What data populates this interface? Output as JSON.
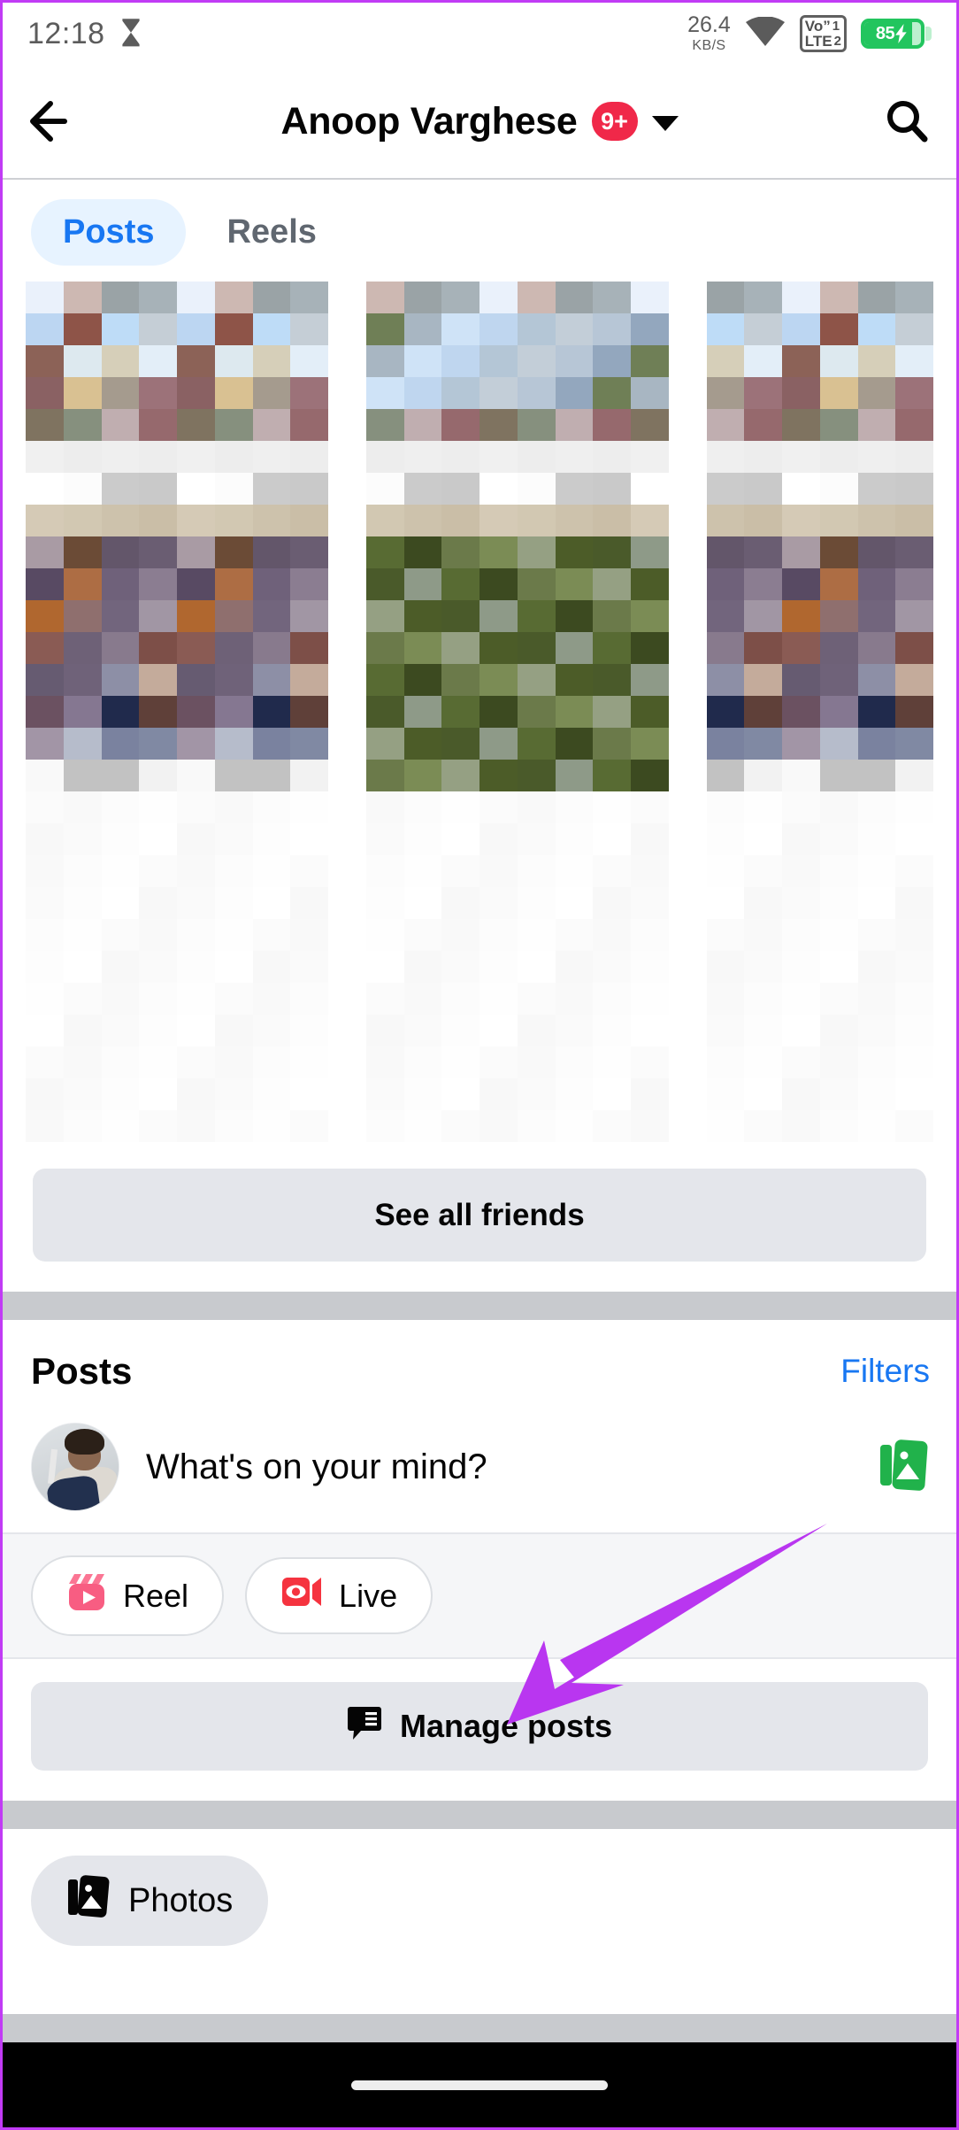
{
  "status_bar": {
    "time": "12:18",
    "hourglass_icon": "hourglass-icon",
    "data_rate_value": "26.4",
    "data_rate_unit": "KB/S",
    "wifi_icon": "wifi-icon",
    "volte_line1": "Vo”",
    "volte_line2": "LTE",
    "sim_slot_top": "1",
    "sim_slot_bottom": "2",
    "battery_percent": "85",
    "battery_charging_icon": "lightning-bolt-icon"
  },
  "header": {
    "back_icon": "back-arrow-icon",
    "title": "Anoop Varghese",
    "badge_count": "9+",
    "dropdown_icon": "chevron-down-icon",
    "search_icon": "search-icon"
  },
  "tabs": [
    {
      "label": "Posts",
      "active": true
    },
    {
      "label": "Reels",
      "active": false
    }
  ],
  "friends_section": {
    "see_all_label": "See all friends"
  },
  "posts_section": {
    "title": "Posts",
    "filters_label": "Filters",
    "composer": {
      "avatar_name": "profile-avatar",
      "placeholder": "What's on your mind?",
      "photo_icon": "photo-gallery-icon"
    },
    "quick_actions": [
      {
        "label": "Reel",
        "icon": "reel-clapperboard-icon",
        "color": "#f85d82"
      },
      {
        "label": "Live",
        "icon": "live-video-camera-icon",
        "color": "#f5333f"
      }
    ],
    "manage_posts": {
      "label": "Manage posts",
      "icon": "manage-posts-icon"
    }
  },
  "photos_section": {
    "label": "Photos",
    "icon": "photos-stack-icon"
  },
  "annotation": {
    "arrow_color": "#b936f0",
    "points_to": "Manage posts"
  },
  "nav_bar": {
    "home_indicator": "home-indicator"
  },
  "colors": {
    "accent_blue": "#1877f2",
    "tab_active_bg": "#e7f3ff",
    "badge_red": "#f02849",
    "button_gray": "#e4e6eb",
    "band_gray": "#c8cace",
    "row_bg": "#f5f6f8",
    "battery_green": "#22c55e",
    "highlight_purple": "#b936f0"
  }
}
